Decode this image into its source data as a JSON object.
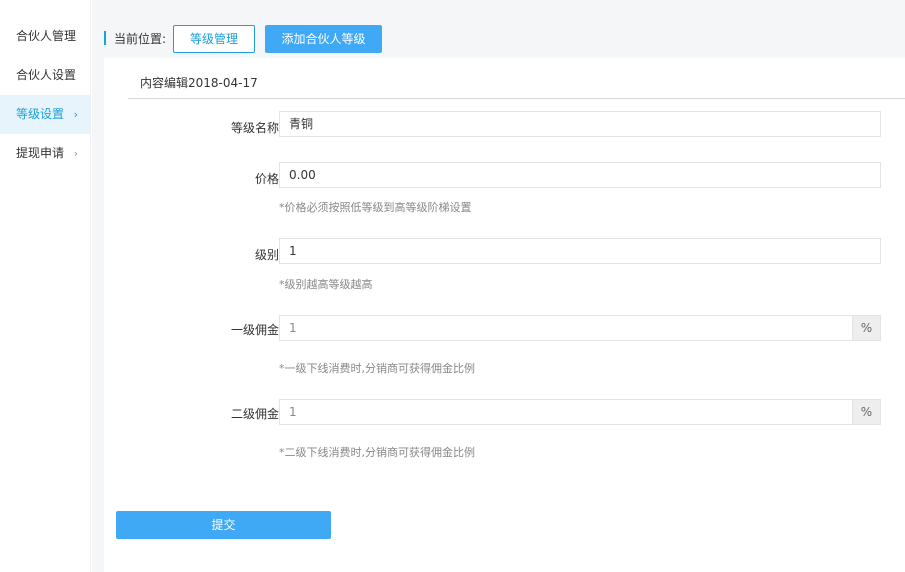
{
  "sidebar": {
    "items": [
      {
        "label": "合伙人管理"
      },
      {
        "label": "合伙人设置"
      },
      {
        "label": "等级设置",
        "chevron": "›"
      },
      {
        "label": "提现申请",
        "chevron": "›"
      }
    ]
  },
  "breadcrumb": {
    "label": "当前位置:",
    "level_manage": "等级管理",
    "add_level": "添加合伙人等级"
  },
  "content": {
    "title": "内容编辑2018-04-17"
  },
  "form": {
    "name": {
      "label": "等级名称",
      "value": "青铜"
    },
    "price": {
      "label": "价格",
      "value": "0.00",
      "hint": "*价格必须按照低等级到高等级阶梯设置"
    },
    "level": {
      "label": "级别",
      "value": "1",
      "hint": "*级别越高等级越高"
    },
    "commission1": {
      "label": "一级佣金",
      "value": "1",
      "suffix": "%",
      "hint": "*一级下线消费时,分销商可获得佣金比例"
    },
    "commission2": {
      "label": "二级佣金",
      "value": "1",
      "suffix": "%",
      "hint": "*二级下线消费时,分销商可获得佣金比例"
    },
    "submit": "提交"
  },
  "colors": {
    "accent": "#1aa0db",
    "button": "#3fa9f5",
    "active_bg": "#e8f4fb"
  }
}
